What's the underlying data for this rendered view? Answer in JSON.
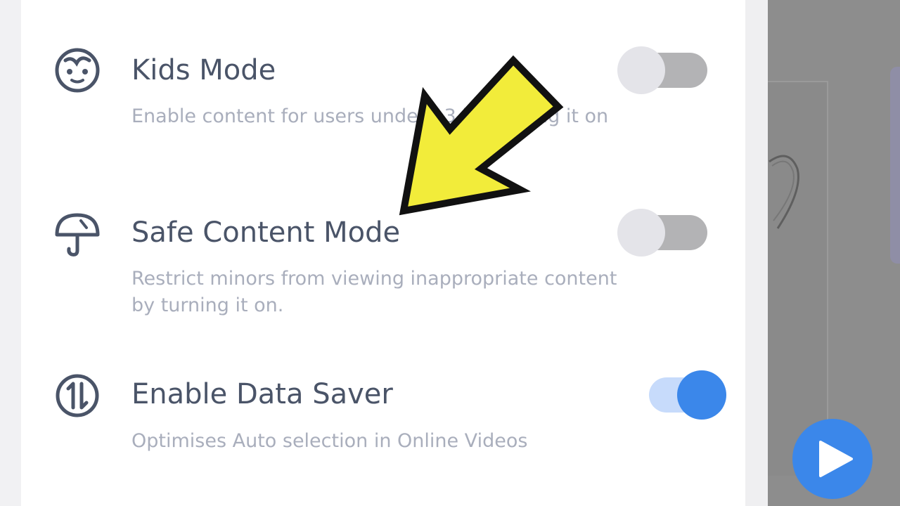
{
  "settings": {
    "kids_mode": {
      "title": "Kids Mode",
      "description": "Enable content for users under 13 by turning it on",
      "enabled": false,
      "icon": "baby-face-icon"
    },
    "safe_content_mode": {
      "title": "Safe Content Mode",
      "description": "Restrict minors from viewing inappropriate content by turning it on.",
      "enabled": false,
      "icon": "umbrella-icon"
    },
    "data_saver": {
      "title": "Enable Data Saver",
      "description": "Optimises Auto selection in Online Videos",
      "enabled": true,
      "icon": "data-transfer-icon"
    }
  },
  "colors": {
    "accent": "#3b87ea",
    "accent_light": "#c7dbfb",
    "toggle_off_track": "#b3b3b5",
    "toggle_off_knob": "#e4e4e9",
    "title_text": "#4a5468",
    "description_text": "#a9aebc",
    "annotation_arrow": "#f2ec3a"
  },
  "overlay": {
    "annotation": "yellow-arrow-pointing-at-safe-content-mode",
    "fab_icon": "play-icon"
  }
}
